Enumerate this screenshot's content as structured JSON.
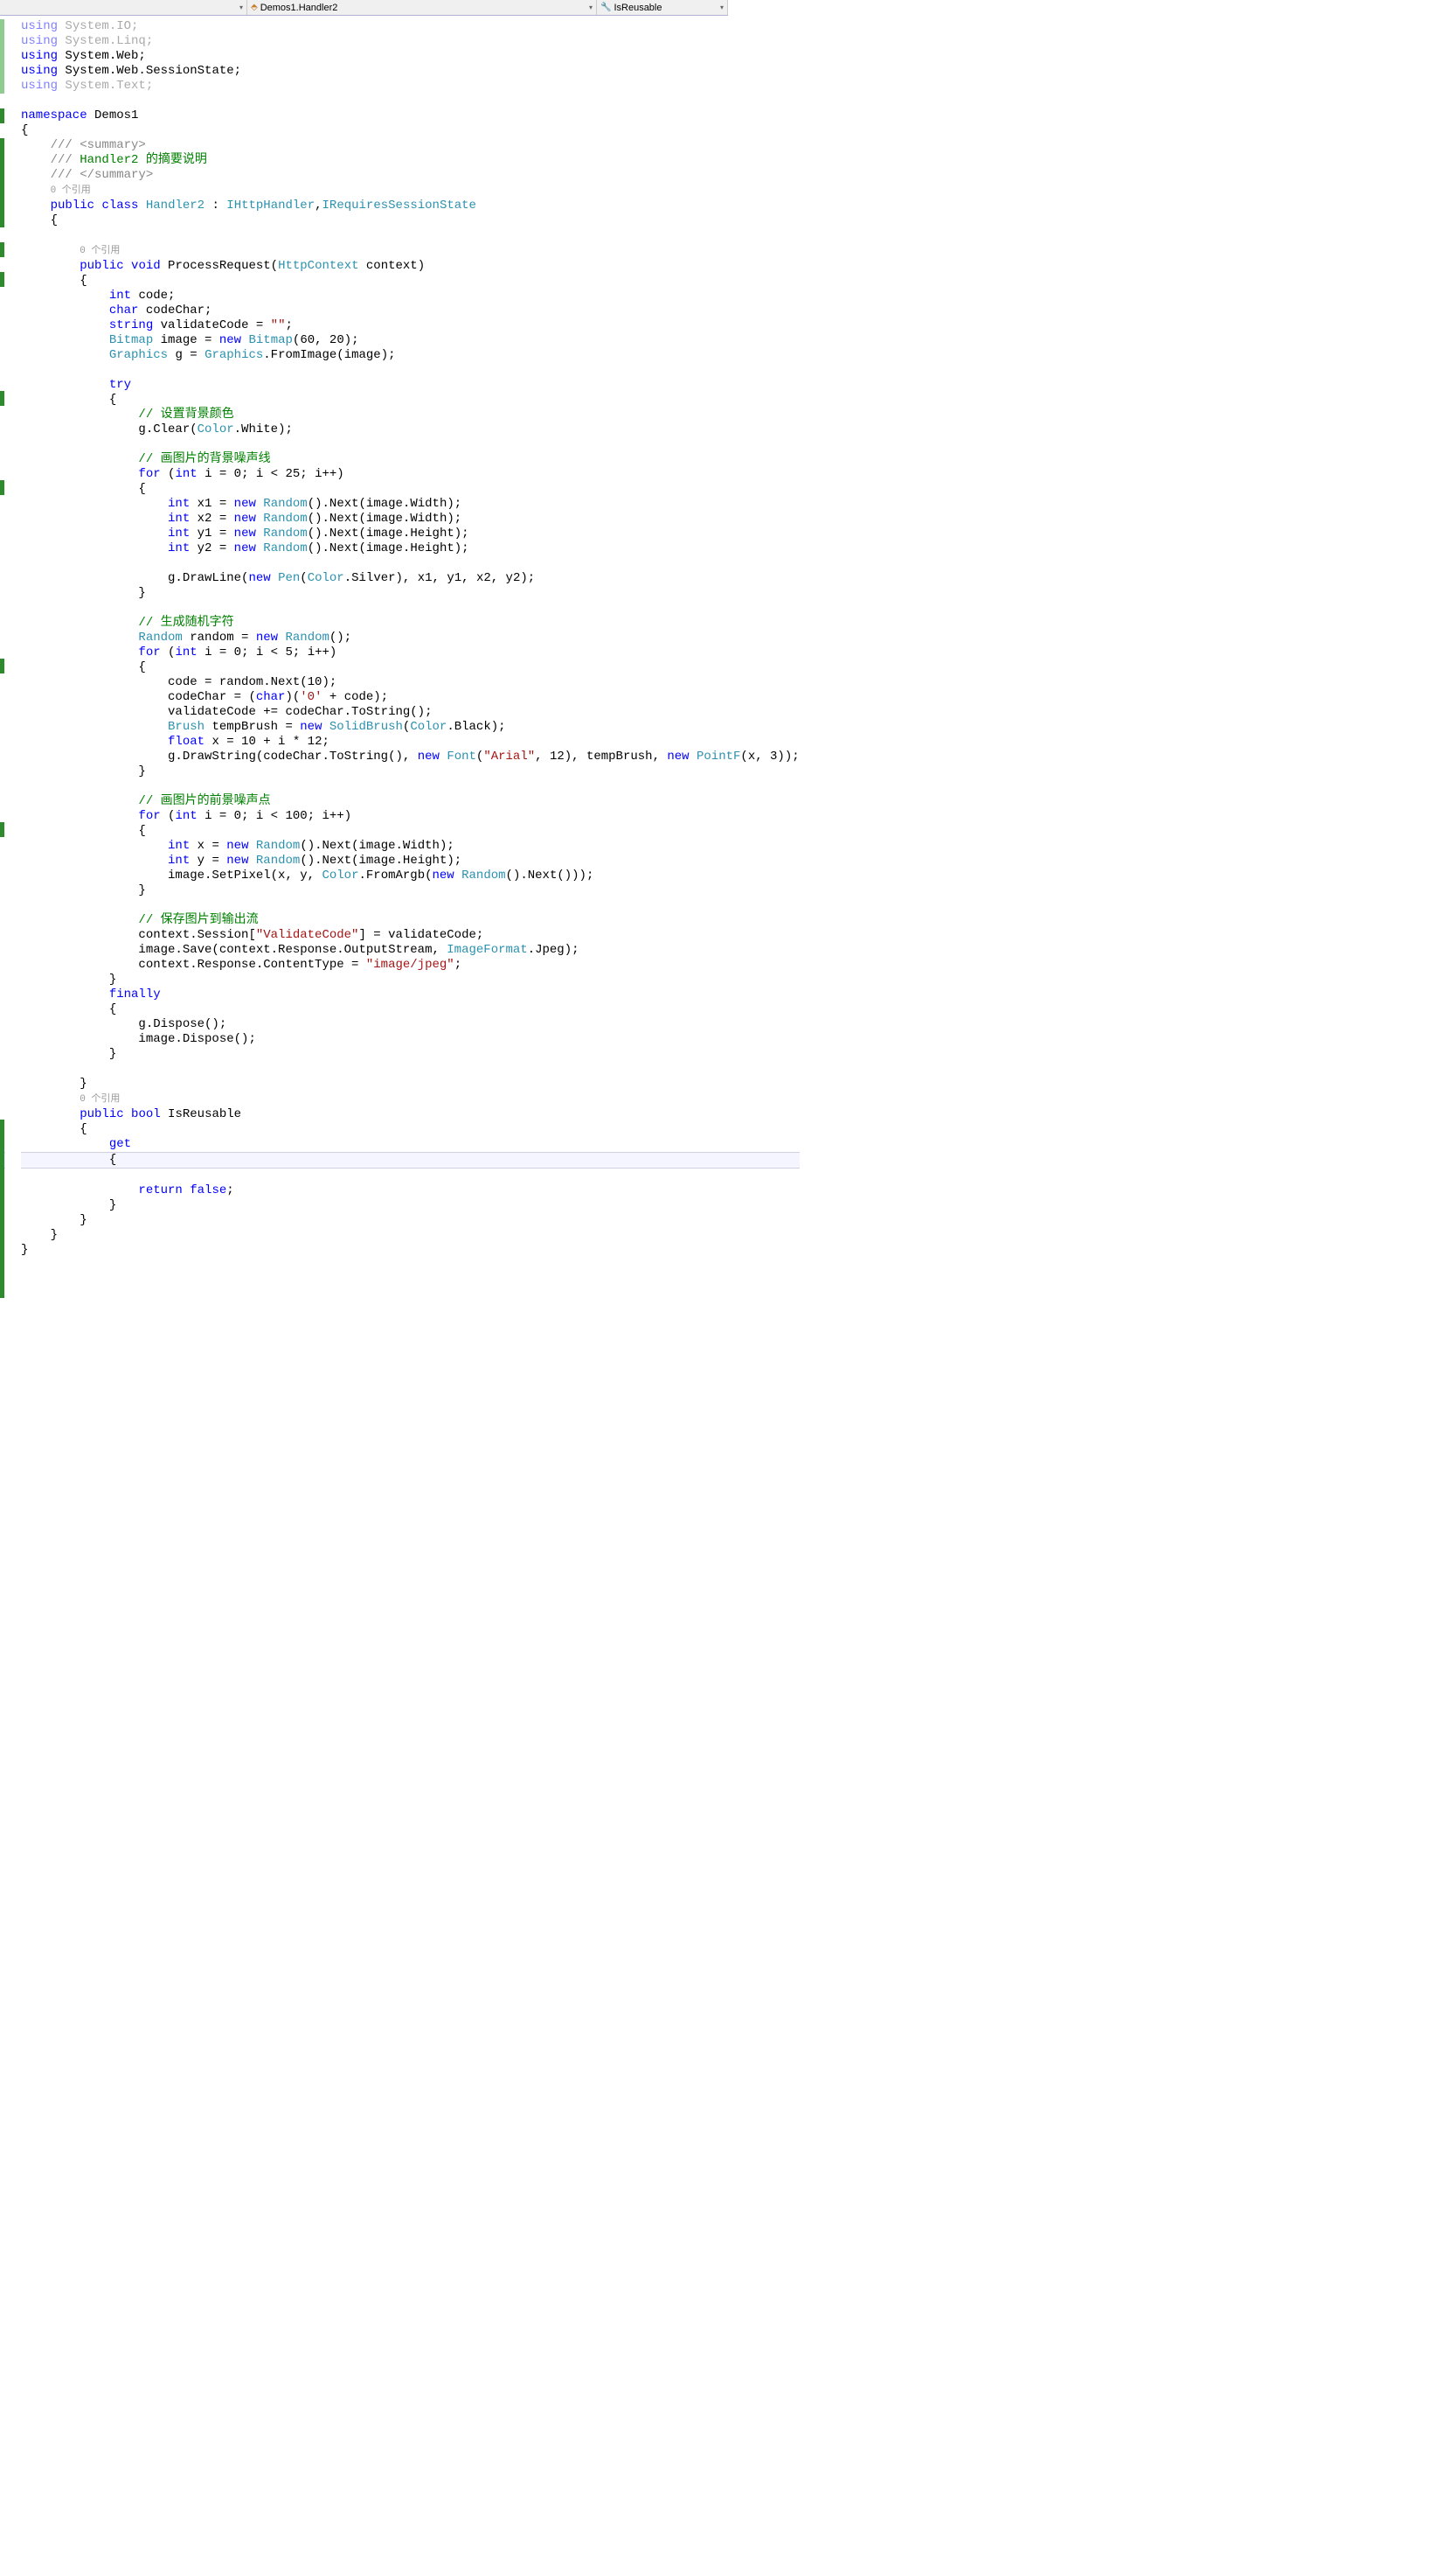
{
  "dropdowns": {
    "left": "",
    "middle": "Demos1.Handler2",
    "right": "IsReusable"
  },
  "code": {
    "usings": [
      {
        "text": "using System.IO;",
        "muted": true
      },
      {
        "text": "using System.Linq;",
        "muted": true
      },
      {
        "text": "using System.Web;",
        "muted": false
      },
      {
        "text": "using System.Web.SessionState;",
        "muted": false
      },
      {
        "text": "using System.Text;",
        "muted": true
      }
    ],
    "namespace": "Demos1",
    "summary1": "/// <summary>",
    "summary2": "/// Handler2 的摘要说明",
    "summary3": "/// </summary>",
    "ref1": "0 个引用",
    "classDecl": {
      "pre": "public class ",
      "name": "Handler2",
      "sep": " : ",
      "i1": "IHttpHandler",
      "comma": ",",
      "i2": "IRequiresSessionState"
    },
    "ref2": "0 个引用",
    "method": {
      "pre": "public void ",
      "name": "ProcessRequest",
      "paren": "(",
      "ptype": "HttpContext",
      "pname": " context)"
    },
    "lines": {
      "l1": "int code;",
      "l2": "char codeChar;",
      "l3a": "string validateCode = ",
      "l3b": "\"\"",
      "l3c": ";",
      "l4a": "Bitmap",
      "l4b": " image = ",
      "l4c": "new ",
      "l4d": "Bitmap",
      "l4e": "(60, 20);",
      "l5a": "Graphics",
      "l5b": " g = ",
      "l5c": "Graphics",
      "l5d": ".FromImage(image);",
      "try": "try",
      "c1": "// 设置背景颜色",
      "l6a": "g.Clear(",
      "l6b": "Color",
      "l6c": ".White);",
      "c2": "// 画图片的背景噪声线",
      "for1a": "for",
      "for1b": " (",
      "for1c": "int",
      "for1d": " i = 0; i < 25; i++)",
      "l7a": "int",
      "l7b": " x1 = ",
      "l7c": "new ",
      "l7d": "Random",
      "l7e": "().Next(image.Width);",
      "l8a": "int",
      "l8b": " x2 = ",
      "l8c": "new ",
      "l8d": "Random",
      "l8e": "().Next(image.Width);",
      "l9a": "int",
      "l9b": " y1 = ",
      "l9c": "new ",
      "l9d": "Random",
      "l9e": "().Next(image.Height);",
      "l10a": "int",
      "l10b": " y2 = ",
      "l10c": "new ",
      "l10d": "Random",
      "l10e": "().Next(image.Height);",
      "l11a": "g.DrawLine(",
      "l11b": "new ",
      "l11c": "Pen",
      "l11d": "(",
      "l11e": "Color",
      "l11f": ".Silver), x1, y1, x2, y2);",
      "c3": "// 生成随机字符",
      "l12a": "Random",
      "l12b": " random = ",
      "l12c": "new ",
      "l12d": "Random",
      "l12e": "();",
      "for2a": "for",
      "for2b": " (",
      "for2c": "int",
      "for2d": " i = 0; i < 5; i++)",
      "l13": "code = random.Next(10);",
      "l14a": "codeChar = (",
      "l14b": "char",
      "l14c": ")(",
      "l14d": "'0'",
      "l14e": " + code);",
      "l15": "validateCode += codeChar.ToString();",
      "l16a": "Brush",
      "l16b": " tempBrush = ",
      "l16c": "new ",
      "l16d": "SolidBrush",
      "l16e": "(",
      "l16f": "Color",
      "l16g": ".Black);",
      "l17a": "float",
      "l17b": " x = 10 + i * 12;",
      "l18a": "g.DrawString(codeChar.ToString(), ",
      "l18b": "new ",
      "l18c": "Font",
      "l18d": "(",
      "l18e": "\"Arial\"",
      "l18f": ", 12), tempBrush, ",
      "l18g": "new ",
      "l18h": "PointF",
      "l18i": "(x, 3));",
      "c4": "// 画图片的前景噪声点",
      "for3a": "for",
      "for3b": " (",
      "for3c": "int",
      "for3d": " i = 0; i < 100; i++)",
      "l19a": "int",
      "l19b": " x = ",
      "l19c": "new ",
      "l19d": "Random",
      "l19e": "().Next(image.Width);",
      "l20a": "int",
      "l20b": " y = ",
      "l20c": "new ",
      "l20d": "Random",
      "l20e": "().Next(image.Height);",
      "l21a": "image.SetPixel(x, y, ",
      "l21b": "Color",
      "l21c": ".FromArgb(",
      "l21d": "new ",
      "l21e": "Random",
      "l21f": "().Next()));",
      "c5": "// 保存图片到输出流",
      "l22a": "context.Session[",
      "l22b": "\"ValidateCode\"",
      "l22c": "] = validateCode;",
      "l23a": "image.Save(context.Response.OutputStream, ",
      "l23b": "ImageFormat",
      "l23c": ".Jpeg);",
      "l24a": "context.Response.ContentType = ",
      "l24b": "\"image/jpeg\"",
      "l24c": ";",
      "finally": "finally",
      "l25": "g.Dispose();",
      "l26": "image.Dispose();",
      "ref3": "0 个引用",
      "prop1a": "public ",
      "prop1b": "bool",
      "prop1c": " IsReusable",
      "get": "get",
      "l27a": "return ",
      "l27b": "false",
      "l27c": ";"
    }
  }
}
